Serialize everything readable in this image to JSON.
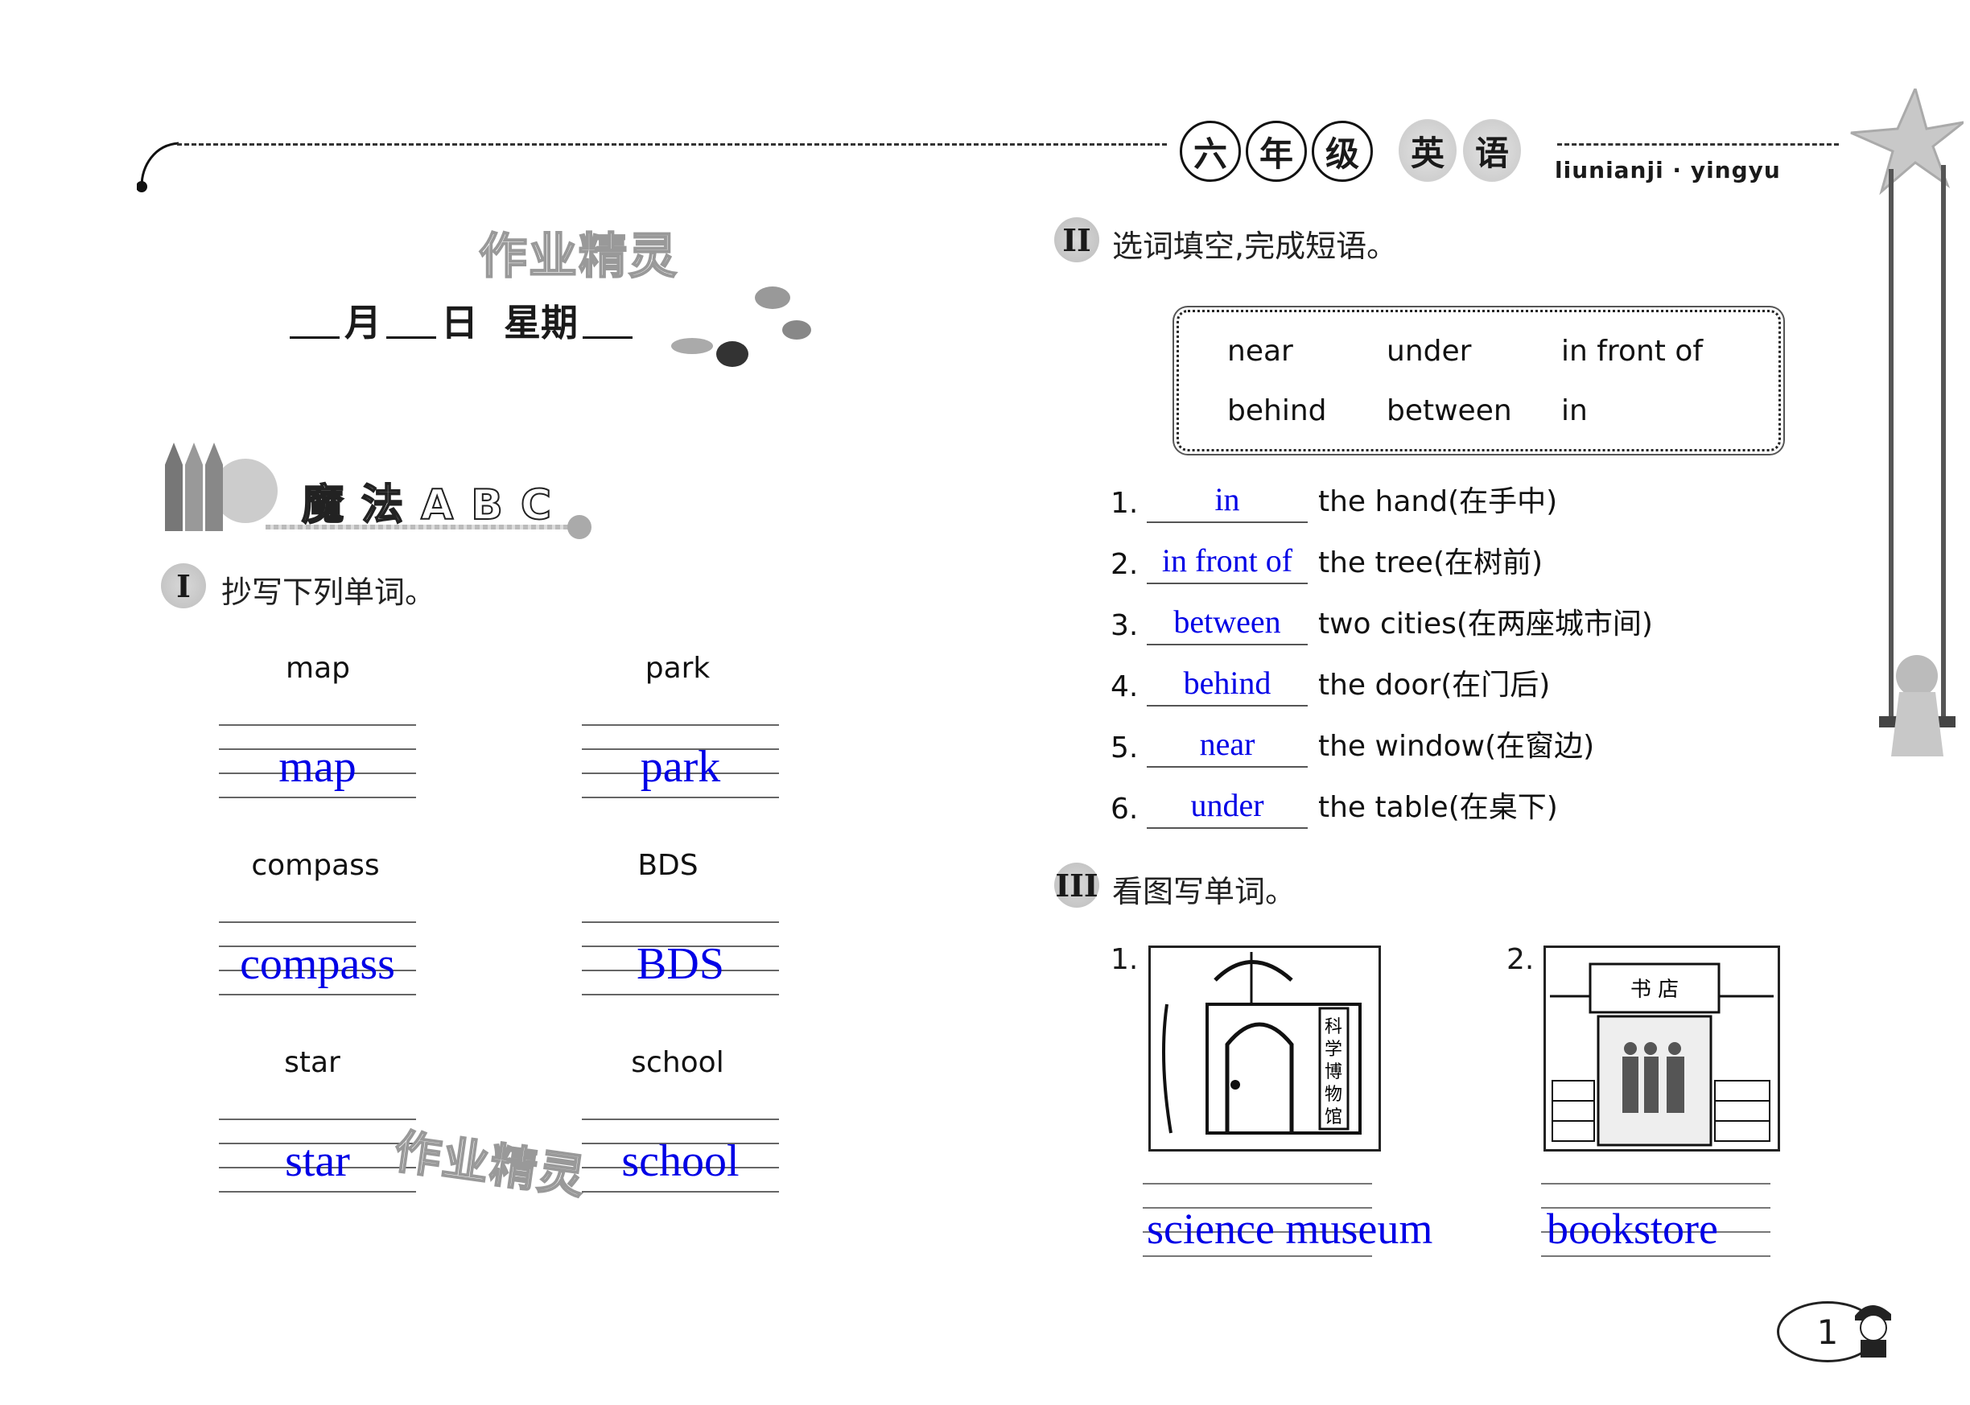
{
  "header": {
    "grade_chars": [
      "六",
      "年",
      "级"
    ],
    "subject_chars": [
      "英",
      "语"
    ],
    "pinyin": "liunianji · yingyu"
  },
  "date_line": {
    "month": "月",
    "day": "日",
    "weekday": "星期"
  },
  "watermark": "作业精灵",
  "banner": {
    "title": "魔法ABC"
  },
  "section1": {
    "numeral": "I",
    "title": "抄写下列单词。",
    "words": [
      {
        "printed": "map",
        "answer": "map"
      },
      {
        "printed": "park",
        "answer": "park"
      },
      {
        "printed": "compass",
        "answer": "compass"
      },
      {
        "printed": "BDS",
        "answer": "BDS"
      },
      {
        "printed": "star",
        "answer": "star"
      },
      {
        "printed": "school",
        "answer": "school"
      }
    ]
  },
  "section2": {
    "numeral": "II",
    "title": "选词填空,完成短语。",
    "word_bank": [
      [
        "near",
        "under",
        "in front of"
      ],
      [
        "behind",
        "between",
        "in"
      ]
    ],
    "items": [
      {
        "num": "1.",
        "answer": "in",
        "text": "the hand(在手中)"
      },
      {
        "num": "2.",
        "answer": "in front of",
        "text": "the tree(在树前)"
      },
      {
        "num": "3.",
        "answer": "between",
        "text": "two cities(在两座城市间)"
      },
      {
        "num": "4.",
        "answer": "behind",
        "text": "the door(在门后)"
      },
      {
        "num": "5.",
        "answer": "near",
        "text": "the window(在窗边)"
      },
      {
        "num": "6.",
        "answer": "under",
        "text": "the table(在桌下)"
      }
    ]
  },
  "section3": {
    "numeral": "III",
    "title": "看图写单词。",
    "items": [
      {
        "num": "1.",
        "sign": "科学博物馆",
        "answer": "science museum"
      },
      {
        "num": "2.",
        "sign": "书 店",
        "answer": "bookstore"
      }
    ]
  },
  "page_number": "1"
}
